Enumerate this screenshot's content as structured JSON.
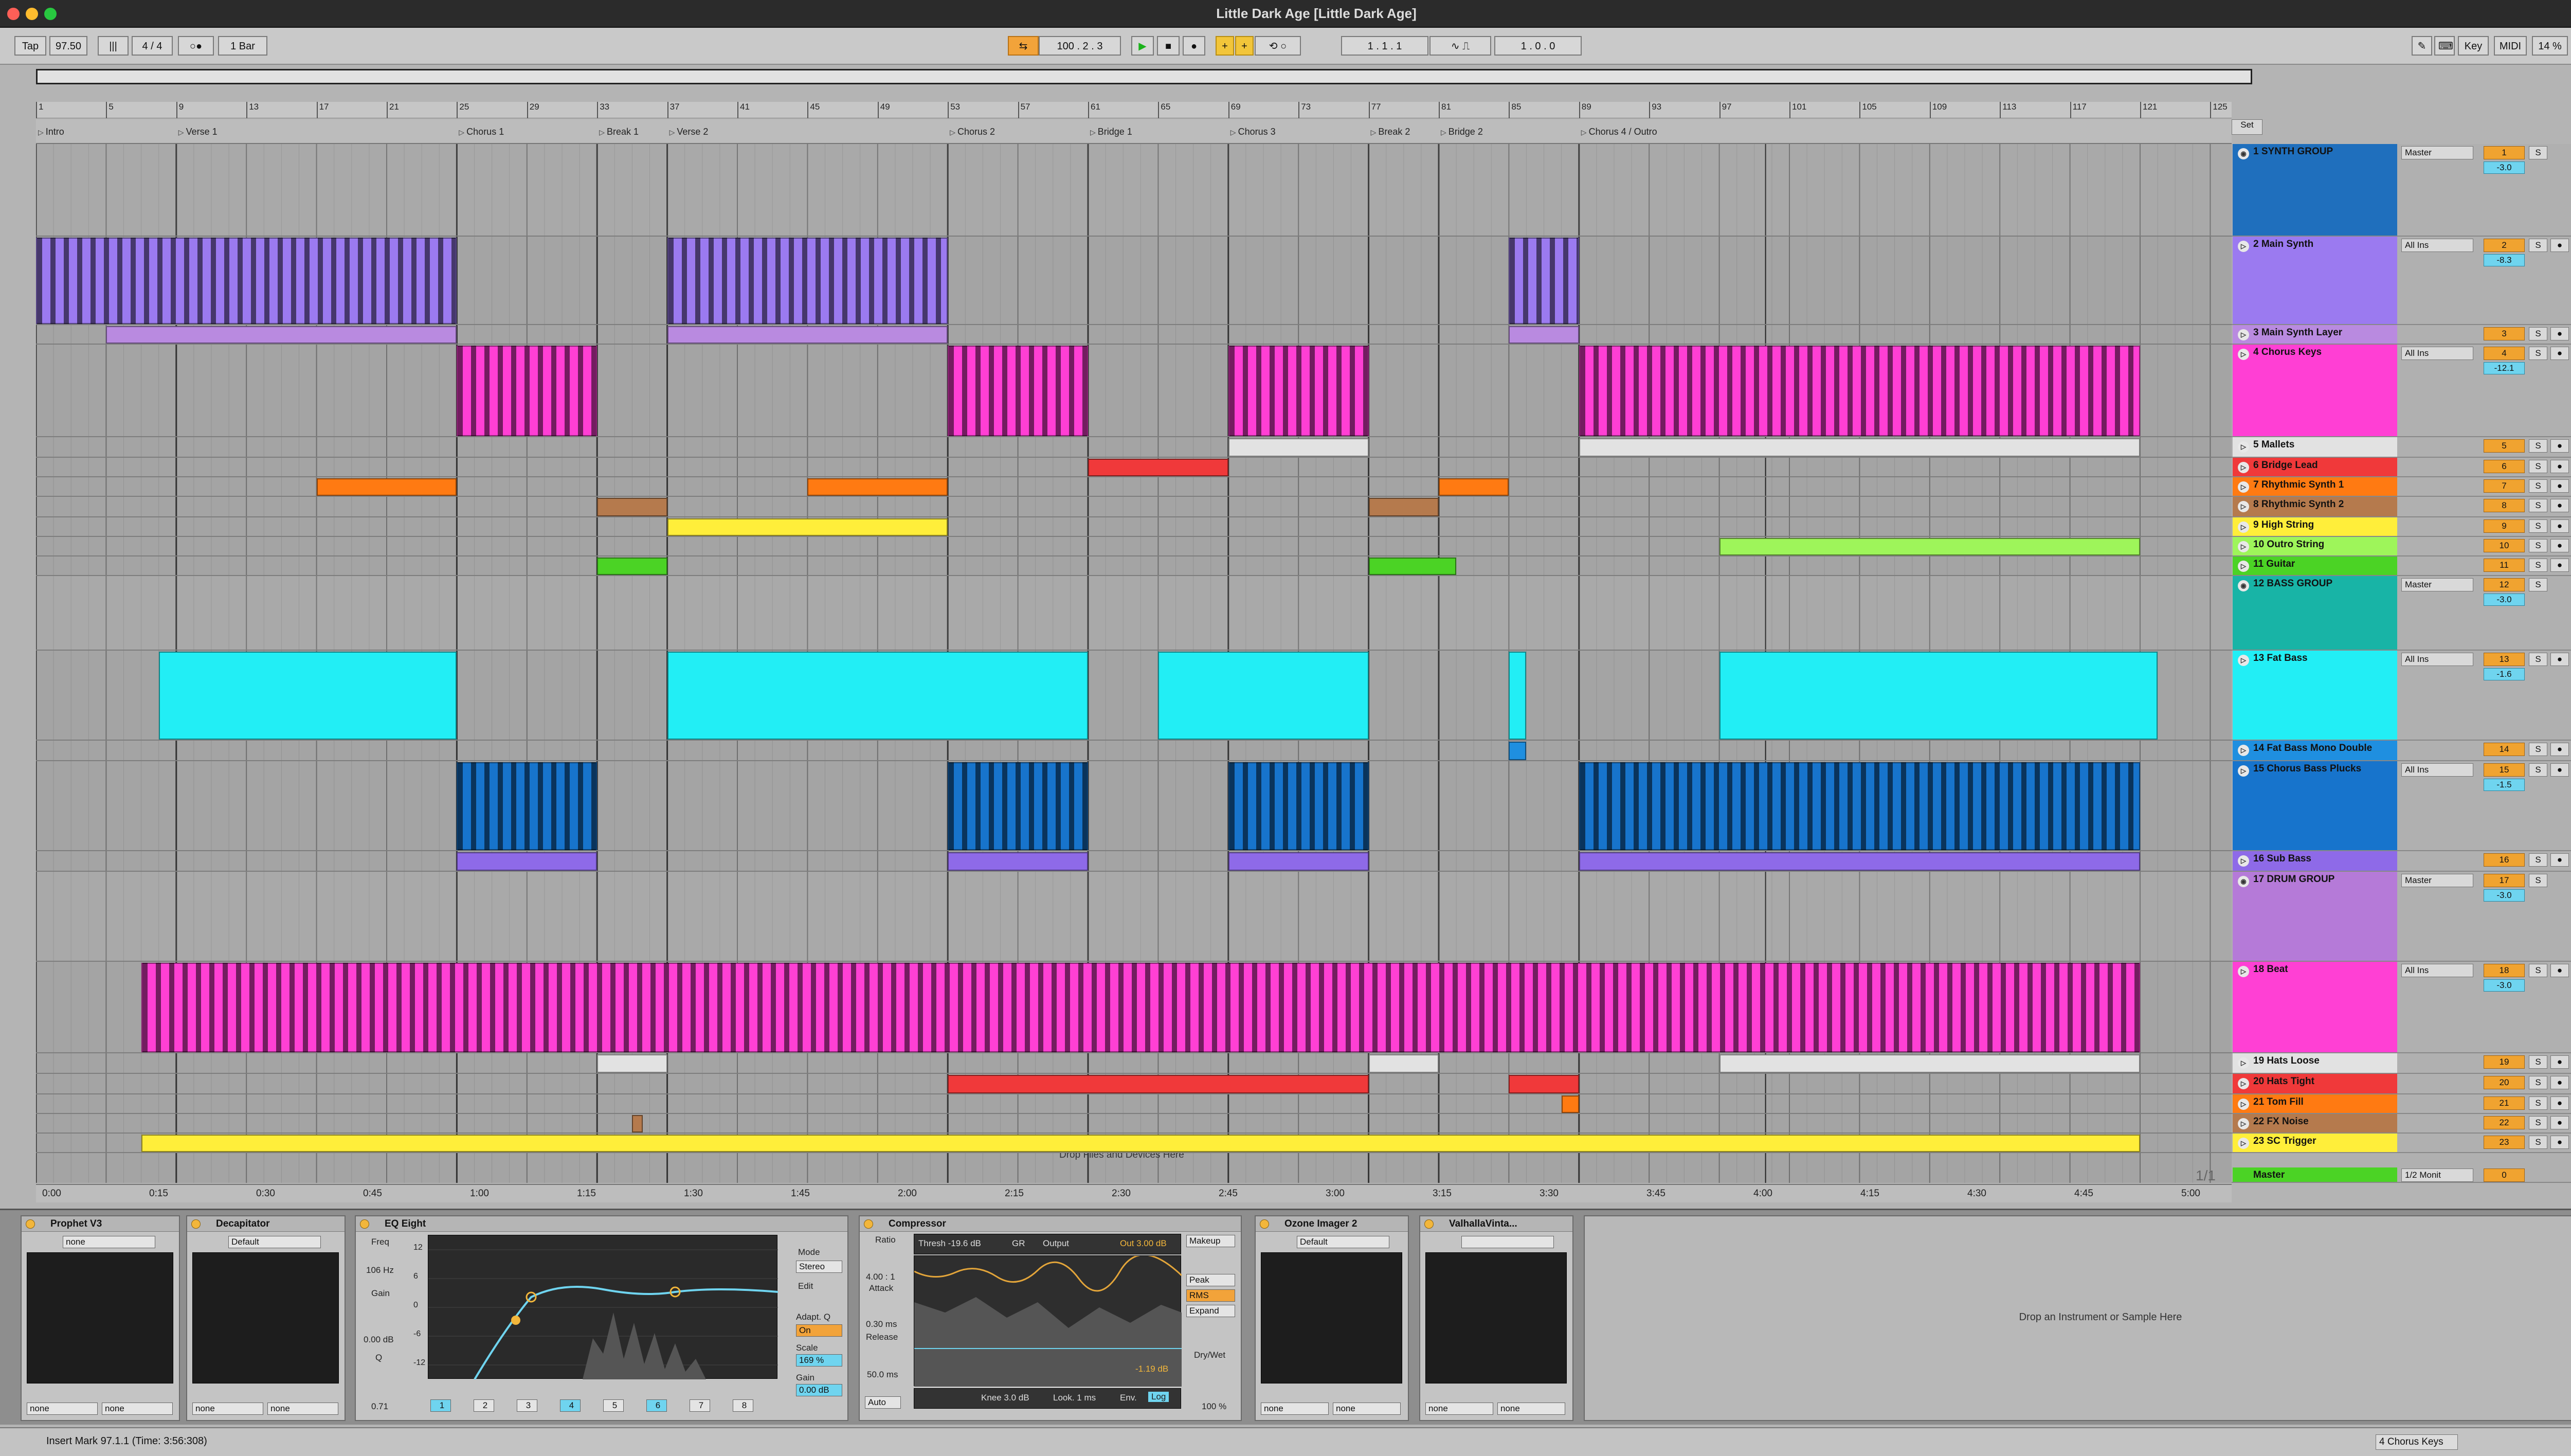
{
  "window": {
    "title": "Little Dark Age  [Little Dark Age]"
  },
  "control_bar": {
    "tap": "Tap",
    "tempo": "97.50",
    "time_signature": "4 / 4",
    "metronome": "○●",
    "quantize": "1 Bar",
    "position": "100 .  2 .  3",
    "loop_start": "1 .  1 .  1",
    "loop_length": "1 .  0 .  0",
    "key_label": "Key",
    "midi_label": "MIDI",
    "cpu": "14 %"
  },
  "arrangement": {
    "set_label": "Set",
    "bar_ticks": [
      "1",
      "5",
      "9",
      "13",
      "17",
      "21",
      "25",
      "29",
      "33",
      "37",
      "41",
      "45",
      "49",
      "53",
      "57",
      "61",
      "65",
      "69",
      "73",
      "77",
      "81",
      "85",
      "89",
      "93",
      "97",
      "101",
      "105",
      "109",
      "113",
      "117",
      "121",
      "125"
    ],
    "locators": [
      "Intro",
      "Verse 1",
      "Chorus 1",
      "Break 1",
      "Verse 2",
      "Chorus 2",
      "Bridge 1",
      "Chorus 3",
      "Break 2",
      "Bridge 2",
      "Chorus 4 / Outro"
    ],
    "time_ticks": [
      "0:00",
      "0:15",
      "0:30",
      "0:45",
      "1:00",
      "1:15",
      "1:30",
      "1:45",
      "2:00",
      "2:15",
      "2:30",
      "2:45",
      "3:00",
      "3:15",
      "3:30",
      "3:45",
      "4:00",
      "4:15",
      "4:30",
      "4:45",
      "5:00"
    ],
    "drop_hint": "Drop Files and Devices Here",
    "page_indicator": "1/1"
  },
  "tracks": [
    {
      "name": "1 SYNTH GROUP",
      "color": "#1f6fbd",
      "io": "Master",
      "num": "1",
      "vol": "-3.0",
      "group": true
    },
    {
      "name": "2 Main Synth",
      "color": "#9b7af0",
      "io": "All Ins",
      "num": "2",
      "vol": "-8.3"
    },
    {
      "name": "3 Main Synth Layer",
      "color": "#b98ae0",
      "io": "",
      "num": "3",
      "vol": ""
    },
    {
      "name": "4 Chorus Keys",
      "color": "#ff3fd4",
      "io": "All Ins",
      "num": "4",
      "vol": "-12.1"
    },
    {
      "name": "5 Mallets",
      "color": "#e2e2e2",
      "io": "",
      "num": "5",
      "vol": ""
    },
    {
      "name": "6 Bridge Lead",
      "color": "#f0393a",
      "io": "",
      "num": "6",
      "vol": ""
    },
    {
      "name": "7 Rhythmic Synth  1",
      "color": "#ff7a12",
      "io": "",
      "num": "7",
      "vol": ""
    },
    {
      "name": "8 Rhythmic Synth 2",
      "color": "#b57a4d",
      "io": "",
      "num": "8",
      "vol": ""
    },
    {
      "name": "9 High String",
      "color": "#ffee3a",
      "io": "",
      "num": "9",
      "vol": ""
    },
    {
      "name": "10 Outro String",
      "color": "#9ef55a",
      "io": "",
      "num": "10",
      "vol": ""
    },
    {
      "name": "11 Guitar",
      "color": "#4bd325",
      "io": "",
      "num": "11",
      "vol": ""
    },
    {
      "name": "12 BASS GROUP",
      "color": "#18b4a6",
      "io": "Master",
      "num": "12",
      "vol": "-3.0",
      "group": true
    },
    {
      "name": "13 Fat Bass",
      "color": "#22eef5",
      "io": "All Ins",
      "num": "13",
      "vol": "-1.6"
    },
    {
      "name": "14 Fat Bass Mono Double",
      "color": "#1f8fe0",
      "io": "",
      "num": "14",
      "vol": ""
    },
    {
      "name": "15 Chorus Bass Plucks",
      "color": "#1774cc",
      "io": "All Ins",
      "num": "15",
      "vol": "-1.5"
    },
    {
      "name": "16 Sub Bass",
      "color": "#8e6ae8",
      "io": "",
      "num": "16",
      "vol": ""
    },
    {
      "name": "17 DRUM GROUP",
      "color": "#b57ad8",
      "io": "Master",
      "num": "17",
      "vol": "-3.0",
      "group": true
    },
    {
      "name": "18 Beat",
      "color": "#ff40d4",
      "io": "All Ins",
      "num": "18",
      "vol": "-3.0"
    },
    {
      "name": "19 Hats Loose",
      "color": "#e2e2e2",
      "io": "",
      "num": "19",
      "vol": ""
    },
    {
      "name": "20 Hats Tight",
      "color": "#f0393a",
      "io": "",
      "num": "20",
      "vol": ""
    },
    {
      "name": "21 Tom Fill",
      "color": "#ff7a12",
      "io": "",
      "num": "21",
      "vol": ""
    },
    {
      "name": "22 FX Noise",
      "color": "#b57a4d",
      "io": "",
      "num": "22",
      "vol": ""
    },
    {
      "name": "23 SC Trigger",
      "color": "#ffee3a",
      "io": "",
      "num": "23",
      "vol": ""
    }
  ],
  "master": {
    "name": "Master",
    "io": "1/2 Monit",
    "num": "0",
    "vol": "0"
  },
  "devices": {
    "prophet": {
      "title": "Prophet V3",
      "preset": "none",
      "out1": "none",
      "out2": "none"
    },
    "decapitator": {
      "title": "Decapitator",
      "preset": "Default",
      "out1": "none",
      "out2": "none"
    },
    "eq": {
      "title": "EQ Eight",
      "freq_label": "Freq",
      "freq": "106 Hz",
      "gain_label": "Gain",
      "gain": "0.00 dB",
      "q_label": "Q",
      "q": "0.71",
      "mode_label": "Mode",
      "mode": "Stereo",
      "edit_label": "Edit",
      "adapt_label": "Adapt. Q",
      "adapt": "On",
      "scale_label": "Scale",
      "scale": "169 %",
      "out_gain_label": "Gain",
      "out_gain": "0.00 dB",
      "bands": [
        "1",
        "2",
        "3",
        "4",
        "5",
        "6",
        "7",
        "8"
      ],
      "db_ticks": [
        "12",
        "6",
        "0",
        "-6",
        "-12"
      ]
    },
    "compressor": {
      "title": "Compressor",
      "ratio_label": "Ratio",
      "ratio": "4.00 : 1",
      "attack_label": "Attack",
      "attack": "0.30 ms",
      "release_label": "Release",
      "release": "50.0 ms",
      "auto": "Auto",
      "thresh": "Thresh -19.6 dB",
      "gr": "GR",
      "output": "Output",
      "out": "Out  3.00 dB",
      "makeup": "Makeup",
      "peak": "Peak",
      "rms": "RMS",
      "expand": "Expand",
      "gr_value": "-1.19 dB",
      "knee": "Knee 3.0 dB",
      "look": "Look. 1 ms",
      "env": "Env.",
      "log": "Log",
      "drywet_label": "Dry/Wet",
      "drywet": "100 %"
    },
    "ozone": {
      "title": "Ozone Imager 2",
      "preset": "Default",
      "out1": "none",
      "out2": "none"
    },
    "valhalla": {
      "title": "ValhallaVinta...",
      "preset": "",
      "out1": "none",
      "out2": "none"
    },
    "drop_hint": "Drop an Instrument or Sample Here"
  },
  "status": {
    "message": "Insert Mark 97.1.1 (Time: 3:56:308)",
    "selected_track": "4 Chorus Keys"
  }
}
